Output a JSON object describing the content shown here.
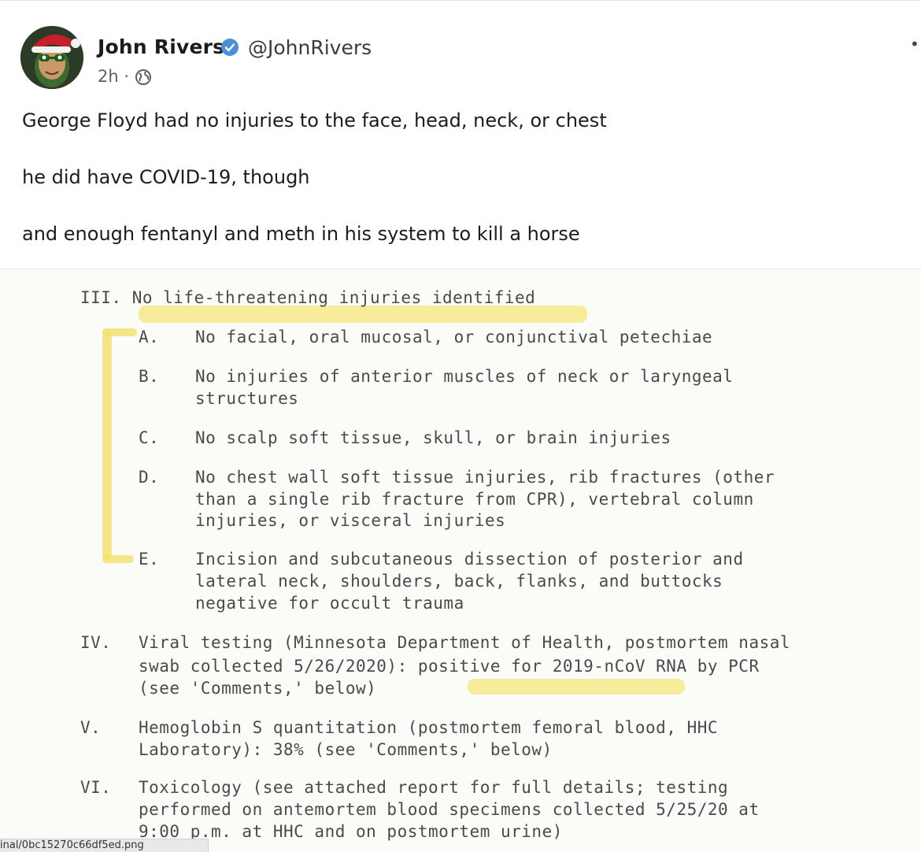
{
  "author": {
    "name": "John Rivers",
    "handle": "@JohnRivers",
    "timestamp": "2h ·",
    "verified_color": "#4a90d9"
  },
  "post": {
    "lines": [
      "George Floyd had no injuries to the face, head, neck, or chest",
      "he did have COVID-19, though",
      "and enough fentanyl and meth in his system to kill a horse"
    ]
  },
  "document": {
    "lines": [
      "III. No life-threatening injuries identified",
      "A.",
      "No facial, oral mucosal, or conjunctival petechiae",
      "B.",
      "No injuries of anterior muscles of neck or laryngeal",
      "structures",
      "C.",
      "No scalp soft tissue, skull, or brain injuries",
      "D.",
      "No chest wall soft tissue injuries, rib fractures (other",
      "than a single rib fracture from CPR), vertebral column",
      "injuries, or visceral injuries",
      "E.",
      "Incision and subcutaneous dissection of posterior and",
      "lateral neck, shoulders, back, flanks, and buttocks",
      "negative for occult trauma",
      "IV.",
      "Viral testing (Minnesota Department of Health, postmortem nasal",
      "swab collected 5/26/2020): positive for 2019-nCoV RNA by PCR",
      "(see 'Comments,' below)",
      "V.",
      "Hemoglobin S quantitation (postmortem femoral blood, HHC",
      "Laboratory): 38% (see 'Comments,' below)",
      "VI.",
      "Toxicology (see attached report for full details; testing",
      "performed on antemortem blood specimens collected 5/25/20 at",
      "9:00 p.m. at HHC and on postmortem urine)"
    ],
    "highlight_color": "#f6e77a"
  },
  "status_bar": {
    "url": "inal/0bc15270c66df5ed.png"
  }
}
